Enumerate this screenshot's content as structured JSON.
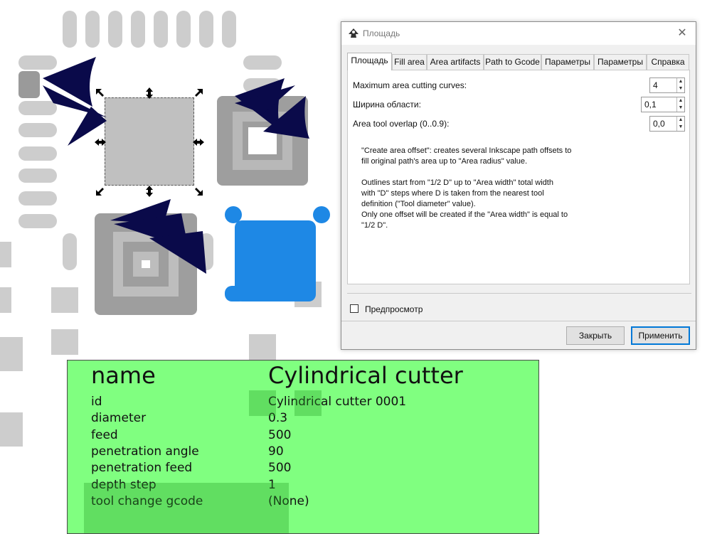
{
  "dialog": {
    "title": "Площадь",
    "close_symbol": "✕",
    "tabs": [
      {
        "label": "Площадь"
      },
      {
        "label": "Fill area"
      },
      {
        "label": "Area artifacts"
      },
      {
        "label": "Path to Gcode"
      },
      {
        "label": "Параметры"
      },
      {
        "label": "Параметры"
      },
      {
        "label": "Справка"
      }
    ],
    "fields": [
      {
        "label": "Maximum area cutting curves:",
        "value": "4"
      },
      {
        "label": "Ширина области:",
        "value": "0,1"
      },
      {
        "label": "Area tool overlap (0..0.9):",
        "value": "0,0"
      }
    ],
    "description": [
      "\"Create area offset\": creates several Inkscape path offsets to",
      "fill original path's area up to \"Area radius\" value.",
      "",
      "Outlines start from \"1/2 D\" up to \"Area width\" total width",
      "with \"D\" steps where D is taken from the nearest tool",
      "definition (\"Tool diameter\" value).",
      "Only one offset will be created if the \"Area width\" is equal to",
      "\"1/2 D\"."
    ],
    "preview_label": "Предпросмотр",
    "preview_checked": false,
    "close_button": "Закрыть",
    "apply_button": "Применить"
  },
  "tool_table": {
    "header_key": "name",
    "header_value": "Cylindrical cutter",
    "rows": [
      {
        "key": "id",
        "value": "Cylindrical cutter 0001"
      },
      {
        "key": "diameter",
        "value": "0.3"
      },
      {
        "key": "feed",
        "value": "500"
      },
      {
        "key": "penetration angle",
        "value": "90"
      },
      {
        "key": "penetration feed",
        "value": "500"
      },
      {
        "key": "depth step",
        "value": "1"
      },
      {
        "key": "tool change gcode",
        "value": "(None)"
      }
    ]
  },
  "colors": {
    "accent": "#0078d7",
    "selected_shape": "#1e88e5",
    "tool_table_bg": "#80ff80",
    "arrow_fill": "#0a0a4a"
  },
  "icons": {
    "app_icon": "inkscape-icon",
    "close": "close-icon",
    "spin_up": "spin-up-icon",
    "spin_down": "spin-down-icon"
  }
}
